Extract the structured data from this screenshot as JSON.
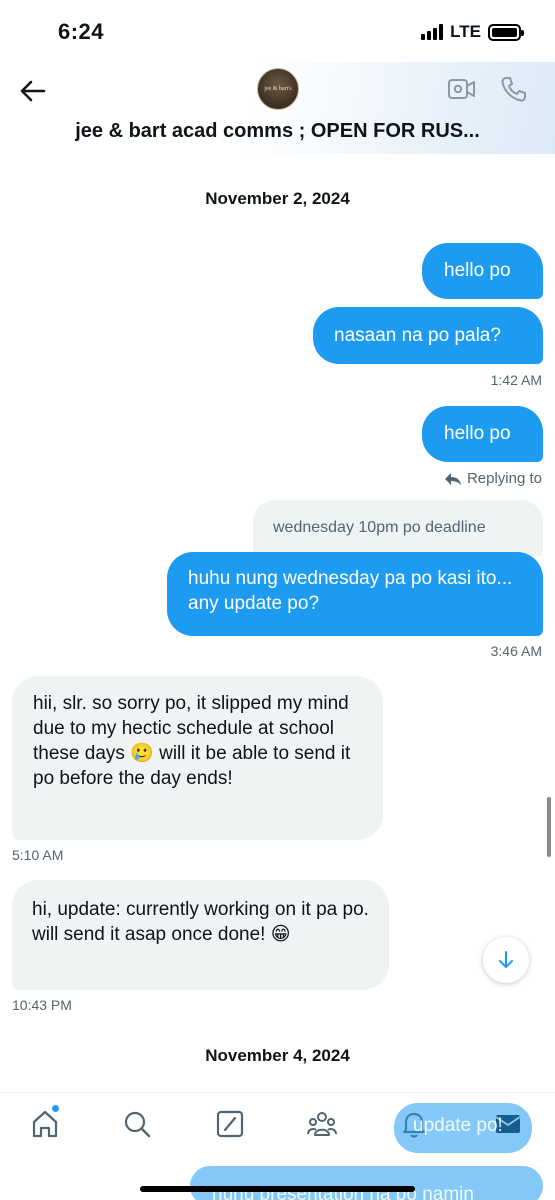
{
  "status_bar": {
    "time": "6:24",
    "network": "LTE"
  },
  "header": {
    "avatar_text": "jee & bart's",
    "title": "jee & bart acad comms ; OPEN FOR RUS..."
  },
  "messages": {
    "date1": "November 2, 2024",
    "m1": "hello po",
    "m2": "nasaan na po pala?",
    "t1": "1:42 AM",
    "m3": "hello po",
    "replying_to": "Replying to",
    "quoted": "wednesday 10pm po deadline",
    "m4": "huhu nung wednesday pa po kasi ito... any update po?",
    "t2": "3:46 AM",
    "r1": "hii, slr. so sorry po, it slipped my mind due to my hectic schedule at school these days 🥲 will it be able to send it po before the day ends!",
    "t3": "5:10 AM",
    "r2": "hi, update: currently working on it pa po. will send it asap once done! 😁",
    "t4": "10:43 PM",
    "date2": "November 4, 2024"
  },
  "overlay": {
    "update_text": "update po!",
    "presentation_text": "nunu presentation na po namin"
  },
  "colors": {
    "accent": "#1d9bf0",
    "received_bg": "#eff3f4",
    "secondary_text": "#536471"
  }
}
